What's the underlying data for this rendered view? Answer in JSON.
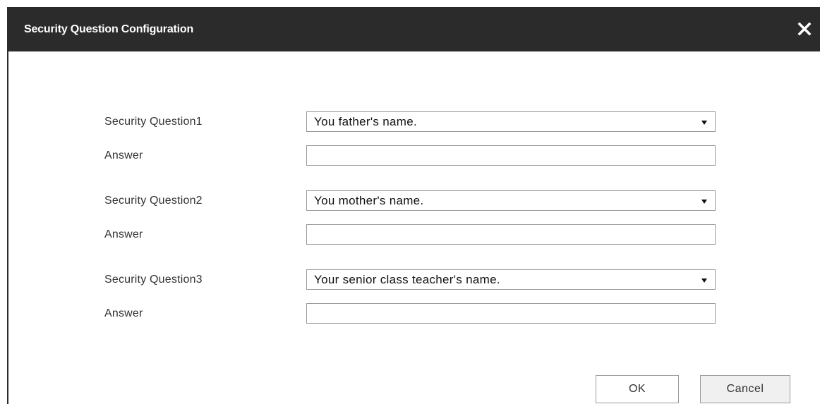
{
  "dialog": {
    "title": "Security Question Configuration",
    "close_icon": "close-icon"
  },
  "questions": [
    {
      "label": "Security Question1",
      "selected": "You father's name.",
      "answer_label": "Answer",
      "answer_value": ""
    },
    {
      "label": "Security Question2",
      "selected": "You mother's name.",
      "answer_label": "Answer",
      "answer_value": ""
    },
    {
      "label": "Security Question3",
      "selected": "Your senior class teacher's name.",
      "answer_label": "Answer",
      "answer_value": ""
    }
  ],
  "buttons": {
    "ok": "OK",
    "cancel": "Cancel"
  },
  "colors": {
    "titlebar": "#2b2b2b",
    "title_text": "#ffffff",
    "border": "#9a9a9a"
  }
}
